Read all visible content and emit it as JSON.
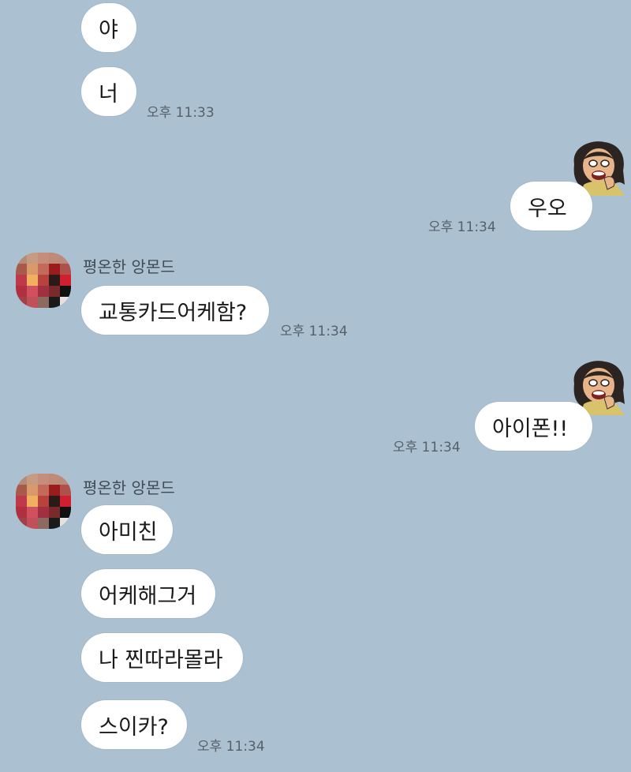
{
  "chat": {
    "messages": [
      {
        "side": "received",
        "text": "야"
      },
      {
        "side": "received",
        "text": "너",
        "time": "오후 11:33"
      },
      {
        "side": "sent",
        "text": "우오",
        "time": "오후 11:34"
      },
      {
        "side": "received",
        "sender": "평온한 앙몬드",
        "text": "교통카드어케함?",
        "time": "오후 11:34"
      },
      {
        "side": "sent",
        "text": "아이폰!!",
        "time": "오후 11:34"
      },
      {
        "side": "received",
        "sender": "평온한 앙몬드",
        "text": "아미친"
      },
      {
        "side": "received",
        "text": "어케해그거"
      },
      {
        "side": "received",
        "text": "나 찐따라몰라"
      },
      {
        "side": "received",
        "text": "스이카?",
        "time": "오후 11:34"
      }
    ]
  },
  "colors": {
    "background": "#abc1d1",
    "bubble": "#ffffff"
  },
  "icons": {
    "sender_avatar": "pixelated-profile-avatar",
    "my_avatar": "cartoon-character-avatar"
  }
}
